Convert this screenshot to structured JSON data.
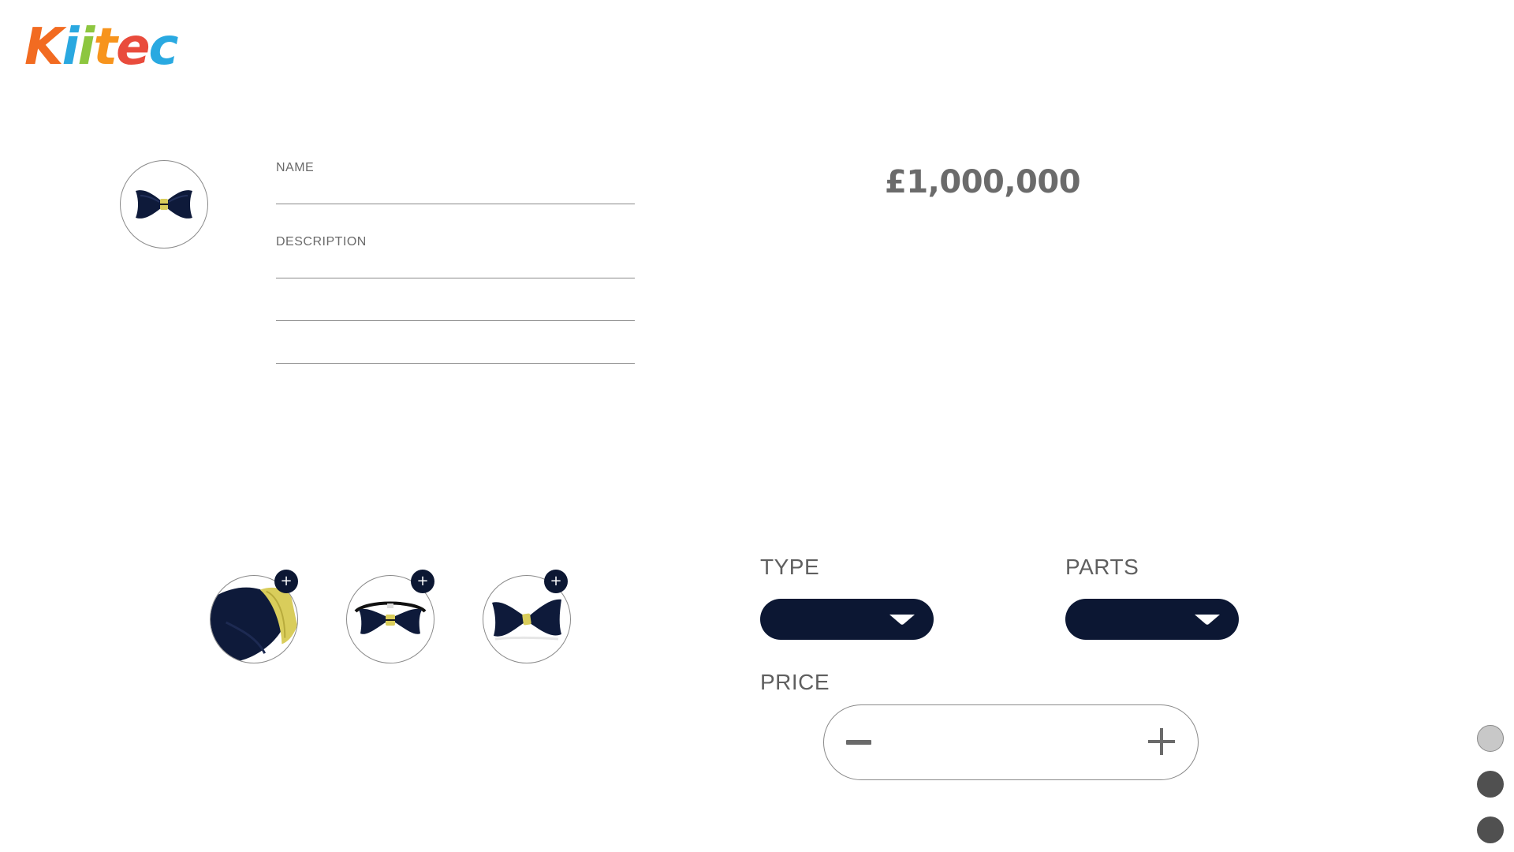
{
  "brand": {
    "name": "Kiitec",
    "letters": [
      {
        "char": "K",
        "color": "#f26b21"
      },
      {
        "char": "i",
        "color": "#2aa8e0"
      },
      {
        "char": "i",
        "color": "#8dc63f"
      },
      {
        "char": "t",
        "color": "#f7941d"
      },
      {
        "char": "e",
        "color": "#e94b3c"
      },
      {
        "char": "c",
        "color": "#29a9e1"
      }
    ]
  },
  "form": {
    "name_label": "NAME",
    "name_value": "",
    "description_label": "DESCRIPTION",
    "description_value": ""
  },
  "price_display": "£1,000,000",
  "thumbnails": [
    {
      "name": "ring-closeup",
      "add_icon": "plus-icon",
      "add_glyph": "+"
    },
    {
      "name": "bowtie-with-strap",
      "add_icon": "plus-icon",
      "add_glyph": "+"
    },
    {
      "name": "bowtie-angled",
      "add_icon": "plus-icon",
      "add_glyph": "+"
    }
  ],
  "selectors": {
    "type_label": "TYPE",
    "parts_label": "PARTS",
    "type_value": "",
    "parts_value": "",
    "dropdown_icon": "chevron-down-icon"
  },
  "price_control": {
    "label": "PRICE",
    "value": "",
    "minus_icon": "minus-icon",
    "plus_icon": "plus-icon"
  },
  "pager": {
    "active_index": 0,
    "count": 3
  },
  "colors": {
    "navy": "#0c1733",
    "gold": "#d9cd5b",
    "line": "#8a8a8a",
    "dot_active": "#c8c8c8",
    "dot_inactive": "#505050"
  }
}
